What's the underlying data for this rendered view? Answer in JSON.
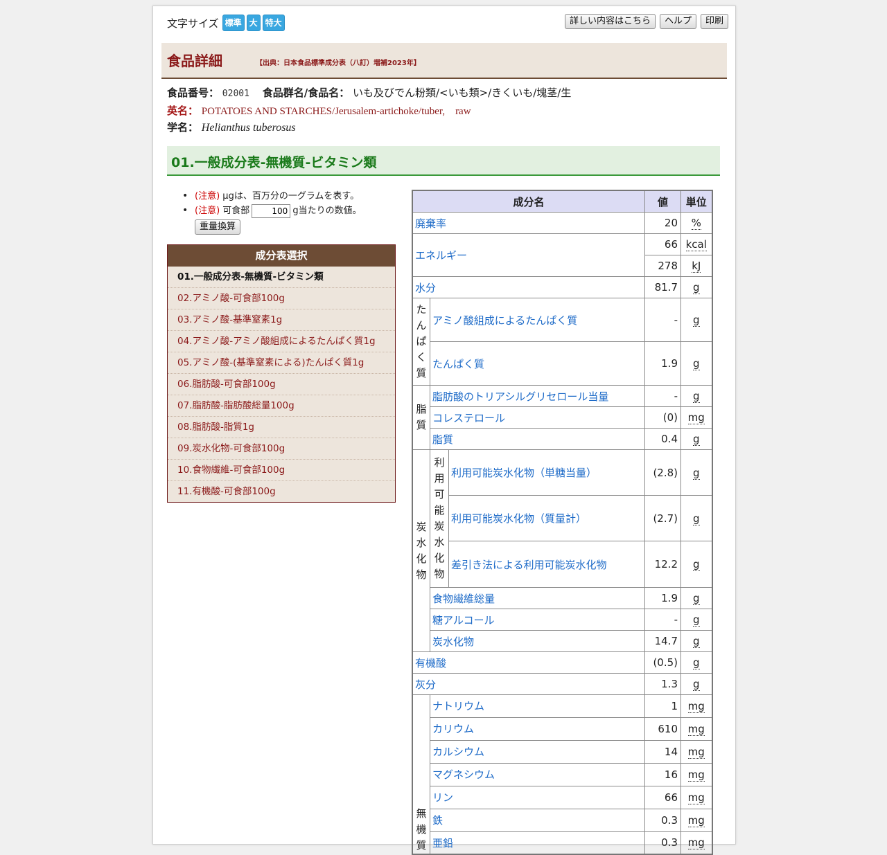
{
  "font_size": {
    "label": "文字サイズ",
    "options": [
      "標準",
      "大",
      "特大"
    ]
  },
  "top_buttons": {
    "details": "詳しい内容はこちら",
    "help": "ヘルプ",
    "print": "印刷"
  },
  "header": {
    "title": "食品詳細",
    "source": "【出典：日本食品標準成分表（八訂）増補2023年】"
  },
  "food": {
    "number_label": "食品番号：",
    "number": "02001",
    "group_label": "食品群名/食品名：",
    "group": "いも及びでん粉類/<いも類>/きくいも/塊茎/生",
    "english_label": "英名：",
    "english": "POTATOES AND STARCHES/Jerusalem-artichoke/tuber,　raw",
    "scientific_label": "学名：",
    "scientific": "Helianthus tuberosus"
  },
  "section_title": "01.一般成分表-無機質-ビタミン類",
  "notes": {
    "note_prefix": "(注意)",
    "note1": "μgは、百万分の一グラムを表す。",
    "note2_before": "可食部",
    "edible_value": "100",
    "note2_after": "g当たりの数値。",
    "convert_button": "重量換算"
  },
  "menu": {
    "title": "成分表選択",
    "items": [
      "01.一般成分表-無機質-ビタミン類",
      "02.アミノ酸-可食部100g",
      "03.アミノ酸-基準窒素1g",
      "04.アミノ酸-アミノ酸組成によるたんぱく質1g",
      "05.アミノ酸-(基準窒素による)たんぱく質1g",
      "06.脂肪酸-可食部100g",
      "07.脂肪酸-脂肪酸総量100g",
      "08.脂肪酸-脂質1g",
      "09.炭水化物-可食部100g",
      "10.食物繊維-可食部100g",
      "11.有機酸-可食部100g"
    ]
  },
  "table": {
    "headers": [
      "成分名",
      "値",
      "単位"
    ],
    "groups": {
      "protein": "たんぱく質",
      "lipid": "脂質",
      "carb": "炭水化物",
      "avail_carb": "利用可能炭水化物",
      "mineral": "無機質"
    },
    "rows": {
      "waste": {
        "name": "廃棄率",
        "value": "20",
        "unit": "%"
      },
      "energy": {
        "name": "エネルギー",
        "value": "66",
        "unit": "kcal"
      },
      "energy_kj": {
        "value": "278",
        "unit": "kJ"
      },
      "water": {
        "name": "水分",
        "value": "81.7",
        "unit": "g"
      },
      "amino_protein": {
        "name": "アミノ酸組成によるたんぱく質",
        "value": "-",
        "unit": "g"
      },
      "protein": {
        "name": "たんぱく質",
        "value": "1.9",
        "unit": "g"
      },
      "tag": {
        "name": "脂肪酸のトリアシルグリセロール当量",
        "value": "-",
        "unit": "g"
      },
      "cholesterol": {
        "name": "コレステロール",
        "value": "(0)",
        "unit": "mg"
      },
      "lipid": {
        "name": "脂質",
        "value": "0.4",
        "unit": "g"
      },
      "carb_mono": {
        "name": "利用可能炭水化物（単糖当量）",
        "value": "(2.8)",
        "unit": "g"
      },
      "carb_mass": {
        "name": "利用可能炭水化物（質量計）",
        "value": "(2.7)",
        "unit": "g"
      },
      "carb_diff": {
        "name": "差引き法による利用可能炭水化物",
        "value": "12.2",
        "unit": "g"
      },
      "fiber": {
        "name": "食物繊維総量",
        "value": "1.9",
        "unit": "g"
      },
      "sugar_alcohol": {
        "name": "糖アルコール",
        "value": "-",
        "unit": "g"
      },
      "carb": {
        "name": "炭水化物",
        "value": "14.7",
        "unit": "g"
      },
      "organic_acid": {
        "name": "有機酸",
        "value": "(0.5)",
        "unit": "g"
      },
      "ash": {
        "name": "灰分",
        "value": "1.3",
        "unit": "g"
      },
      "sodium": {
        "name": "ナトリウム",
        "value": "1",
        "unit": "mg"
      },
      "potassium": {
        "name": "カリウム",
        "value": "610",
        "unit": "mg"
      },
      "calcium": {
        "name": "カルシウム",
        "value": "14",
        "unit": "mg"
      },
      "magnesium": {
        "name": "マグネシウム",
        "value": "16",
        "unit": "mg"
      },
      "phosphorus": {
        "name": "リン",
        "value": "66",
        "unit": "mg"
      },
      "iron": {
        "name": "鉄",
        "value": "0.3",
        "unit": "mg"
      },
      "zinc": {
        "name": "亜鉛",
        "value": "0.3",
        "unit": "mg"
      }
    }
  }
}
